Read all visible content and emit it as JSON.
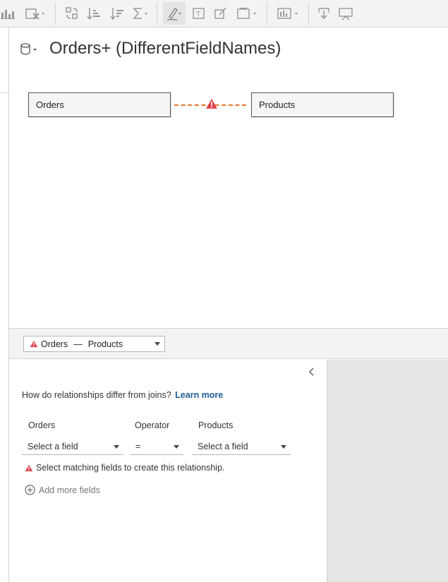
{
  "toolbar": {
    "items": [
      {
        "icon": "show-me-chart-icon"
      },
      {
        "icon": "clear-sheet-icon",
        "dropdown": true
      },
      {
        "icon": "swap-rows-columns-icon"
      },
      {
        "icon": "sort-ascending-icon"
      },
      {
        "icon": "sort-descending-icon"
      },
      {
        "icon": "totals-sigma-icon",
        "dropdown": true
      },
      {
        "icon": "highlight-icon",
        "dropdown": true
      },
      {
        "icon": "show-labels-icon"
      },
      {
        "icon": "format-workbook-icon"
      },
      {
        "icon": "fit-view-icon",
        "dropdown": true
      },
      {
        "icon": "show-me-icon",
        "dropdown": true
      },
      {
        "icon": "download-icon"
      },
      {
        "icon": "presentation-mode-icon"
      }
    ]
  },
  "datasource": {
    "title": "Orders+ (DifferentFieldNames)",
    "icon": "database-icon"
  },
  "canvas": {
    "tables": [
      {
        "name": "Orders"
      },
      {
        "name": "Products"
      }
    ],
    "relationship_status": "warning",
    "line_color": "#e8762b",
    "warning_color": "#e0434b"
  },
  "relationship_selector": {
    "left": "Orders",
    "separator": "—",
    "right": "Products"
  },
  "panel": {
    "question": "How do relationships differ from joins?",
    "learn_more": "Learn more",
    "columns": {
      "left": "Orders",
      "operator": "Operator",
      "right": "Products"
    },
    "left_field": "Select a field",
    "operator_value": "=",
    "right_field": "Select a field",
    "message": "Select matching fields to create this relationship.",
    "add_more": "Add more fields"
  }
}
